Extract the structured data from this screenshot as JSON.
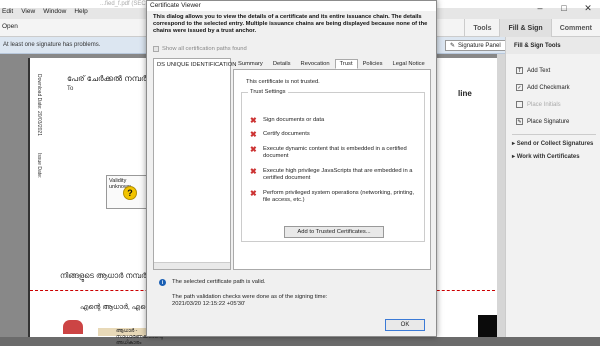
{
  "acrobat": {
    "app_title": "...fied_f.pdf (SECURED)...",
    "menu": [
      "Edit",
      "View",
      "Window",
      "Help"
    ],
    "open_label": "Open",
    "tabs": [
      "Tools",
      "Fill & Sign",
      "Comment"
    ],
    "warning": "At least one signature has problems.",
    "signature_panel": "Signature Panel",
    "page": {
      "header_text": "പേര് ചേർക്കൽ നമ്പർ/ Enrolment",
      "to_text": "To",
      "right_text": "line",
      "rot_download": "Download Date: 20/03/2021",
      "rot_issue": "Issue Date:",
      "validity_label": "Validity unknown",
      "validity_mark": "?",
      "bottom_line_1": "നിങ്ങളുടെ ആധാർ നമ്പർ / Y",
      "bottom_line_2": "എന്റെ ആധാർ, എന്റെ",
      "bottom_strip": "ആധാർ - സാധാരണക്കാരന്റെ അധികാരം"
    },
    "right_panel": {
      "title": "Fill & Sign Tools",
      "items": [
        {
          "label": "Add Text",
          "icon": "text-icon",
          "enabled": true
        },
        {
          "label": "Add Checkmark",
          "icon": "checkmark-icon",
          "enabled": true
        },
        {
          "label": "Place Initials",
          "icon": "initials-icon",
          "enabled": false
        },
        {
          "label": "Place Signature",
          "icon": "signature-icon",
          "enabled": true
        }
      ],
      "sections": [
        "Send or Collect Signatures",
        "Work with Certificates"
      ]
    }
  },
  "dialog": {
    "title": "Certificate Viewer",
    "description": "This dialog allows you to view the details of a certificate and its entire issuance chain. The details correspond to the selected entry. Multiple issuance chains are being displayed because none of the chains were issued by a trust anchor.",
    "show_all_paths": "Show all certification paths found",
    "chain_entry": "DS UNIQUE IDENTIFICATION",
    "tabs": [
      "Summary",
      "Details",
      "Revocation",
      "Trust",
      "Policies",
      "Legal Notice"
    ],
    "active_tab": "Trust",
    "trust_status": "This certificate is not trusted.",
    "trust_settings_title": "Trust Settings",
    "trust_items": [
      "Sign documents or data",
      "Certify documents",
      "Execute dynamic content that is embedded in a certified document",
      "Execute high privilege JavaScripts that are embedded in a certified document",
      "Perform privileged system operations (networking, printing, file access, etc.)"
    ],
    "add_trusted_button": "Add to Trusted Certificates...",
    "path_valid": "The selected certificate path is valid.",
    "path_validation_line1": "The path validation checks were done as of the signing time:",
    "path_validation_line2": "2021/03/20 12:15:22 +05'30'",
    "ok_button": "OK"
  }
}
